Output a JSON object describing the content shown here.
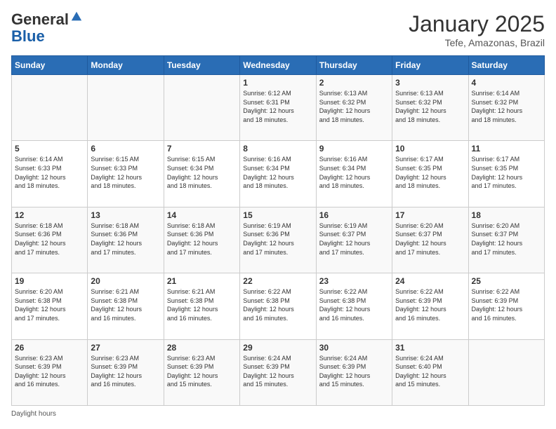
{
  "logo": {
    "general": "General",
    "blue": "Blue"
  },
  "title": "January 2025",
  "subtitle": "Tefe, Amazonas, Brazil",
  "days_of_week": [
    "Sunday",
    "Monday",
    "Tuesday",
    "Wednesday",
    "Thursday",
    "Friday",
    "Saturday"
  ],
  "weeks": [
    [
      {
        "num": "",
        "info": ""
      },
      {
        "num": "",
        "info": ""
      },
      {
        "num": "",
        "info": ""
      },
      {
        "num": "1",
        "info": "Sunrise: 6:12 AM\nSunset: 6:31 PM\nDaylight: 12 hours\nand 18 minutes."
      },
      {
        "num": "2",
        "info": "Sunrise: 6:13 AM\nSunset: 6:32 PM\nDaylight: 12 hours\nand 18 minutes."
      },
      {
        "num": "3",
        "info": "Sunrise: 6:13 AM\nSunset: 6:32 PM\nDaylight: 12 hours\nand 18 minutes."
      },
      {
        "num": "4",
        "info": "Sunrise: 6:14 AM\nSunset: 6:32 PM\nDaylight: 12 hours\nand 18 minutes."
      }
    ],
    [
      {
        "num": "5",
        "info": "Sunrise: 6:14 AM\nSunset: 6:33 PM\nDaylight: 12 hours\nand 18 minutes."
      },
      {
        "num": "6",
        "info": "Sunrise: 6:15 AM\nSunset: 6:33 PM\nDaylight: 12 hours\nand 18 minutes."
      },
      {
        "num": "7",
        "info": "Sunrise: 6:15 AM\nSunset: 6:34 PM\nDaylight: 12 hours\nand 18 minutes."
      },
      {
        "num": "8",
        "info": "Sunrise: 6:16 AM\nSunset: 6:34 PM\nDaylight: 12 hours\nand 18 minutes."
      },
      {
        "num": "9",
        "info": "Sunrise: 6:16 AM\nSunset: 6:34 PM\nDaylight: 12 hours\nand 18 minutes."
      },
      {
        "num": "10",
        "info": "Sunrise: 6:17 AM\nSunset: 6:35 PM\nDaylight: 12 hours\nand 18 minutes."
      },
      {
        "num": "11",
        "info": "Sunrise: 6:17 AM\nSunset: 6:35 PM\nDaylight: 12 hours\nand 17 minutes."
      }
    ],
    [
      {
        "num": "12",
        "info": "Sunrise: 6:18 AM\nSunset: 6:36 PM\nDaylight: 12 hours\nand 17 minutes."
      },
      {
        "num": "13",
        "info": "Sunrise: 6:18 AM\nSunset: 6:36 PM\nDaylight: 12 hours\nand 17 minutes."
      },
      {
        "num": "14",
        "info": "Sunrise: 6:18 AM\nSunset: 6:36 PM\nDaylight: 12 hours\nand 17 minutes."
      },
      {
        "num": "15",
        "info": "Sunrise: 6:19 AM\nSunset: 6:36 PM\nDaylight: 12 hours\nand 17 minutes."
      },
      {
        "num": "16",
        "info": "Sunrise: 6:19 AM\nSunset: 6:37 PM\nDaylight: 12 hours\nand 17 minutes."
      },
      {
        "num": "17",
        "info": "Sunrise: 6:20 AM\nSunset: 6:37 PM\nDaylight: 12 hours\nand 17 minutes."
      },
      {
        "num": "18",
        "info": "Sunrise: 6:20 AM\nSunset: 6:37 PM\nDaylight: 12 hours\nand 17 minutes."
      }
    ],
    [
      {
        "num": "19",
        "info": "Sunrise: 6:20 AM\nSunset: 6:38 PM\nDaylight: 12 hours\nand 17 minutes."
      },
      {
        "num": "20",
        "info": "Sunrise: 6:21 AM\nSunset: 6:38 PM\nDaylight: 12 hours\nand 16 minutes."
      },
      {
        "num": "21",
        "info": "Sunrise: 6:21 AM\nSunset: 6:38 PM\nDaylight: 12 hours\nand 16 minutes."
      },
      {
        "num": "22",
        "info": "Sunrise: 6:22 AM\nSunset: 6:38 PM\nDaylight: 12 hours\nand 16 minutes."
      },
      {
        "num": "23",
        "info": "Sunrise: 6:22 AM\nSunset: 6:38 PM\nDaylight: 12 hours\nand 16 minutes."
      },
      {
        "num": "24",
        "info": "Sunrise: 6:22 AM\nSunset: 6:39 PM\nDaylight: 12 hours\nand 16 minutes."
      },
      {
        "num": "25",
        "info": "Sunrise: 6:22 AM\nSunset: 6:39 PM\nDaylight: 12 hours\nand 16 minutes."
      }
    ],
    [
      {
        "num": "26",
        "info": "Sunrise: 6:23 AM\nSunset: 6:39 PM\nDaylight: 12 hours\nand 16 minutes."
      },
      {
        "num": "27",
        "info": "Sunrise: 6:23 AM\nSunset: 6:39 PM\nDaylight: 12 hours\nand 16 minutes."
      },
      {
        "num": "28",
        "info": "Sunrise: 6:23 AM\nSunset: 6:39 PM\nDaylight: 12 hours\nand 15 minutes."
      },
      {
        "num": "29",
        "info": "Sunrise: 6:24 AM\nSunset: 6:39 PM\nDaylight: 12 hours\nand 15 minutes."
      },
      {
        "num": "30",
        "info": "Sunrise: 6:24 AM\nSunset: 6:39 PM\nDaylight: 12 hours\nand 15 minutes."
      },
      {
        "num": "31",
        "info": "Sunrise: 6:24 AM\nSunset: 6:40 PM\nDaylight: 12 hours\nand 15 minutes."
      },
      {
        "num": "",
        "info": ""
      }
    ]
  ],
  "footer": {
    "daylight_hours_label": "Daylight hours"
  }
}
